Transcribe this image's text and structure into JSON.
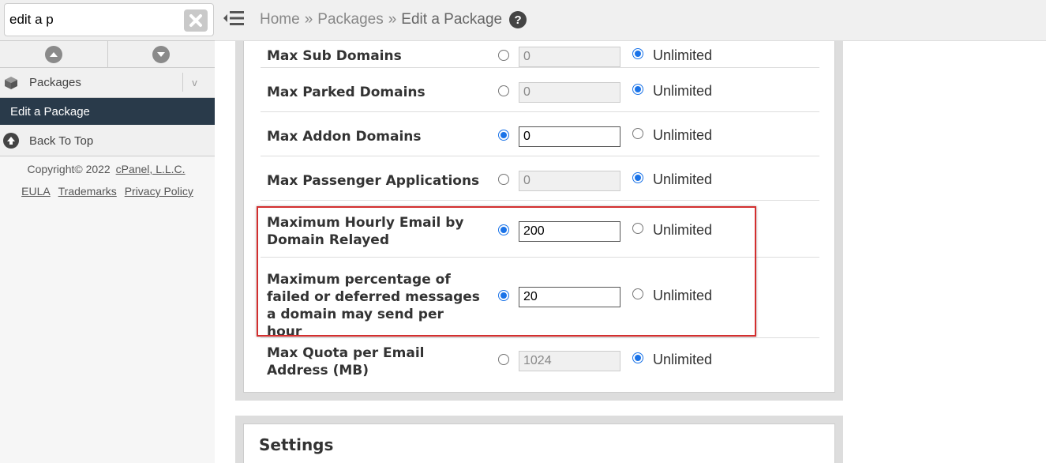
{
  "search": {
    "value": "edit a p"
  },
  "sidebar": {
    "packages_label": "Packages",
    "chevron": "v",
    "edit_label": "Edit a Package",
    "back_to_top_label": "Back To Top",
    "copyright_prefix": "Copyright© 2022 ",
    "copyright_link": "cPanel, L.L.C.",
    "links": [
      "EULA",
      "Trademarks",
      "Privacy Policy"
    ]
  },
  "breadcrumb": {
    "home": "Home",
    "packages": "Packages",
    "current": "Edit a Package",
    "sep": "»"
  },
  "help_glyph": "?",
  "unlimited_label": "Unlimited",
  "rows": [
    {
      "label": "Max Sub Domains",
      "value": "0",
      "selected": "unlimited"
    },
    {
      "label": "Max Parked Domains",
      "value": "0",
      "selected": "unlimited"
    },
    {
      "label": "Max Addon Domains",
      "value": "0",
      "selected": "value"
    },
    {
      "label": "Max Passenger Applications",
      "value": "0",
      "selected": "unlimited"
    },
    {
      "label": "Maximum Hourly Email by Domain Relayed",
      "value": "200",
      "selected": "value"
    },
    {
      "label": "Maximum percentage of failed or deferred messages a domain may send per hour",
      "value": "20",
      "selected": "value"
    },
    {
      "label": "Max Quota per Email Address (MB)",
      "value": "1024",
      "selected": "unlimited"
    }
  ],
  "settings_heading": "Settings",
  "colors": {
    "accent": "#1a73e8",
    "highlight": "#d32f2f",
    "nav_active": "#293a4a"
  }
}
